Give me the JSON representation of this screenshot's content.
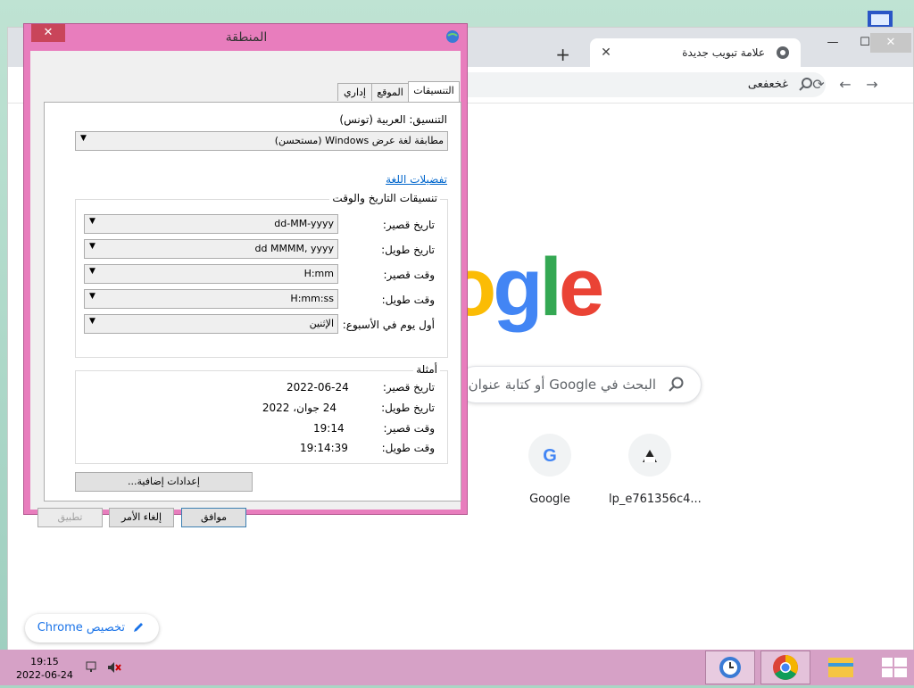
{
  "chrome": {
    "tab_title": "علامة تبويب جديدة",
    "omnibox_text": "غخعفعى",
    "search_placeholder": "البحث في Google أو كتابة عنوان",
    "shortcuts": [
      {
        "label": "Google",
        "icon": "google-g-icon"
      },
      {
        "label": "lp_e761356c4...",
        "icon": "site-icon"
      }
    ],
    "customize_label": "تخصيص Chrome",
    "logo_text": "ogle"
  },
  "dialog": {
    "title": "المنطقة",
    "tabs": [
      "التنسيقات",
      "الموقع",
      "إداري"
    ],
    "format_label": "التنسيق: العربية (تونس)",
    "format_value": "مطابقة لغة عرض Windows (مستحسن)",
    "language_prefs_link": "تفضيلات اللغة",
    "datetime_group_title": "تنسيقات التاريخ والوقت",
    "datetime_rows": [
      {
        "label": "تاريخ قصير:",
        "value": "dd-MM-yyyy"
      },
      {
        "label": "تاريخ طويل:",
        "value": "dd MMMM, yyyy"
      },
      {
        "label": "وقت قصير:",
        "value": "H:mm"
      },
      {
        "label": "وقت طويل:",
        "value": "H:mm:ss"
      },
      {
        "label": "أول يوم في الأسبوع:",
        "value": "الإثنين"
      }
    ],
    "examples_group_title": "أمثلة",
    "examples": [
      {
        "label": "تاريخ قصير:",
        "value": "2022-06-24"
      },
      {
        "label": "تاريخ طويل:",
        "value": "24 جوان، 2022"
      },
      {
        "label": "وقت قصير:",
        "value": "19:14"
      },
      {
        "label": "وقت طويل:",
        "value": "19:14:39"
      }
    ],
    "additional_settings": "إعدادات إضافية...",
    "ok": "موافق",
    "cancel": "إلغاء الأمر",
    "apply": "تطبيق"
  },
  "taskbar": {
    "time": "19:15",
    "date": "2022-06-24"
  }
}
